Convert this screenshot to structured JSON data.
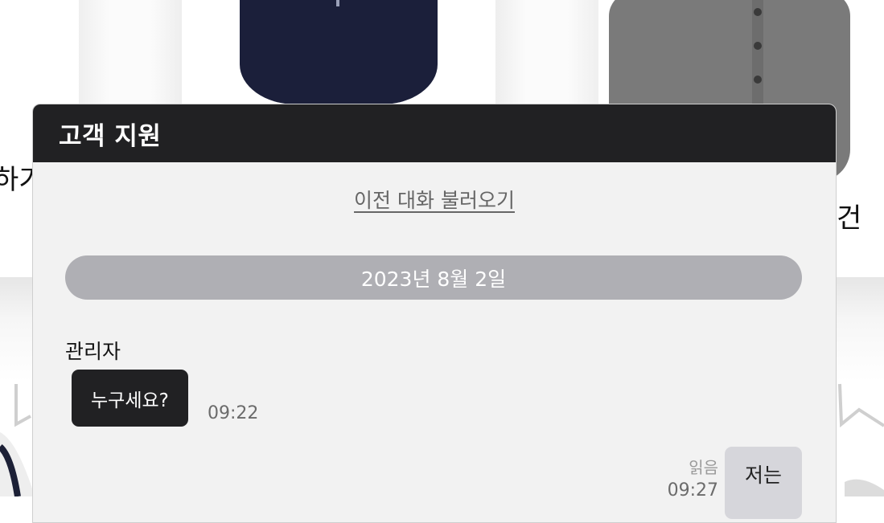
{
  "background": {
    "left_fragment": "하기",
    "right_fragment": "건"
  },
  "chat": {
    "title": "고객 지원",
    "load_previous": "이전 대화 불러오기",
    "date_divider": "2023년 8월 2일",
    "messages": [
      {
        "sender": "관리자",
        "text": "누구세요?",
        "time": "09:22",
        "direction": "incoming"
      },
      {
        "text": "저는",
        "time": "09:27",
        "status": "읽음",
        "direction": "outgoing"
      }
    ]
  },
  "colors": {
    "header_bg": "#212123",
    "chat_bg": "#f2f2f2",
    "date_pill": "#afafb4",
    "incoming_bubble": "#212123",
    "outgoing_bubble": "#d6d6db"
  }
}
